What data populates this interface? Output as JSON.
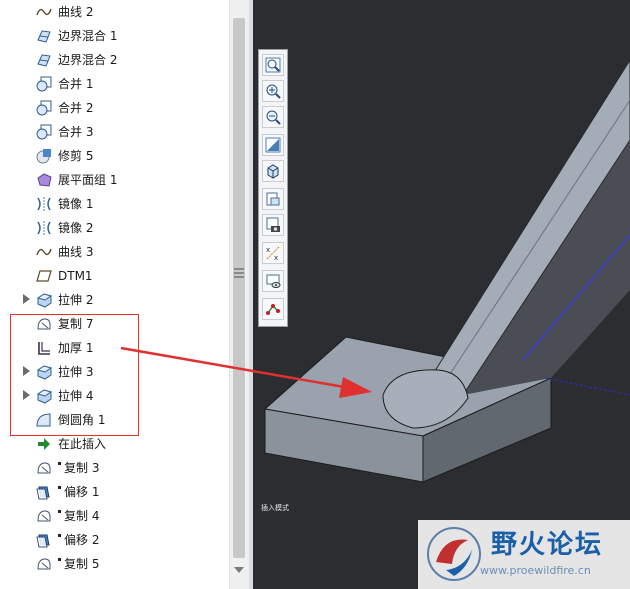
{
  "model_tree": {
    "items": [
      {
        "label": "曲线 2",
        "icon": "curve-icon",
        "expand": false,
        "marked": false
      },
      {
        "label": "边界混合 1",
        "icon": "boundary-blend-icon",
        "expand": false,
        "marked": false
      },
      {
        "label": "边界混合 2",
        "icon": "boundary-blend-icon",
        "expand": false,
        "marked": false
      },
      {
        "label": "合并 1",
        "icon": "merge-icon",
        "expand": false,
        "marked": false
      },
      {
        "label": "合并 2",
        "icon": "merge-icon",
        "expand": false,
        "marked": false
      },
      {
        "label": "合并 3",
        "icon": "merge-icon",
        "expand": false,
        "marked": false
      },
      {
        "label": "修剪 5",
        "icon": "trim-icon",
        "expand": false,
        "marked": false
      },
      {
        "label": "展平面组 1",
        "icon": "flatten-quilt-icon",
        "expand": false,
        "marked": false
      },
      {
        "label": "镜像 1",
        "icon": "mirror-icon",
        "expand": false,
        "marked": false
      },
      {
        "label": "镜像 2",
        "icon": "mirror-icon",
        "expand": false,
        "marked": false
      },
      {
        "label": "曲线 3",
        "icon": "curve-icon",
        "expand": false,
        "marked": false
      },
      {
        "label": "DTM1",
        "icon": "datum-plane-icon",
        "expand": false,
        "marked": false
      },
      {
        "label": "拉伸 2",
        "icon": "extrude-icon",
        "expand": true,
        "marked": false
      },
      {
        "label": "复制 7",
        "icon": "copy-icon",
        "expand": false,
        "marked": false
      },
      {
        "label": "加厚 1",
        "icon": "thicken-icon",
        "expand": false,
        "marked": false
      },
      {
        "label": "拉伸 3",
        "icon": "extrude-icon",
        "expand": true,
        "marked": false
      },
      {
        "label": "拉伸 4",
        "icon": "extrude-icon",
        "expand": true,
        "marked": false
      },
      {
        "label": "倒圆角 1",
        "icon": "round-icon",
        "expand": false,
        "marked": false
      },
      {
        "label": "在此插入",
        "icon": "insert-here-arrow-icon",
        "expand": false,
        "marked": false
      },
      {
        "label": "复制 3",
        "icon": "copy-icon",
        "expand": false,
        "marked": true
      },
      {
        "label": "偏移 1",
        "icon": "offset-icon",
        "expand": false,
        "marked": true
      },
      {
        "label": "复制 4",
        "icon": "copy-icon",
        "expand": false,
        "marked": true
      },
      {
        "label": "偏移 2",
        "icon": "offset-icon",
        "expand": false,
        "marked": true
      },
      {
        "label": "复制 5",
        "icon": "copy-icon",
        "expand": false,
        "marked": true
      }
    ]
  },
  "view_toolbar": {
    "buttons": [
      "refit-icon",
      "zoom-in-icon",
      "zoom-out-icon",
      "repaint-icon",
      "display-style-icon",
      "saved-views-icon",
      "perspective-icon",
      "datum-display-icon",
      "spin-center-icon",
      "annotation-icon"
    ]
  },
  "viewport": {
    "mode_label": "插入模式",
    "background": "#2b2d31",
    "annotation_color": "#e03030"
  },
  "watermark": {
    "title": "野火论坛",
    "url": "www.proewildfire.cn"
  }
}
